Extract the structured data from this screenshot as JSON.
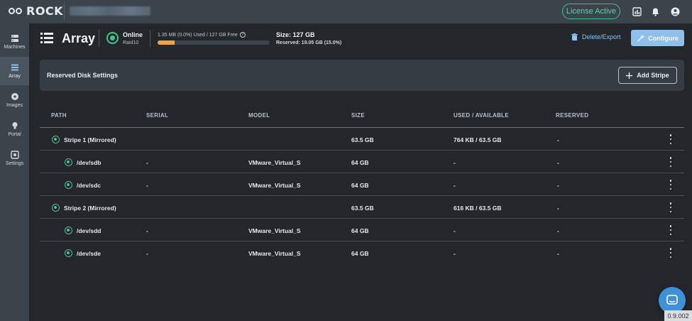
{
  "app": {
    "logo_text": "ROCK",
    "license_label": "License Active",
    "version": "0.9.002"
  },
  "sidebar": {
    "items": [
      {
        "label": "Machines"
      },
      {
        "label": "Array"
      },
      {
        "label": "Images"
      },
      {
        "label": "Portal"
      },
      {
        "label": "Settings"
      }
    ]
  },
  "header": {
    "title": "Array",
    "status": "Online",
    "raid": "Raid10",
    "usage_text": "1.35 MB (0.0%) Used / 127 GB Free",
    "usage_percent": 15,
    "size": "Size: 127 GB",
    "reserved": "Reserved: 19.05 GB (15.0%)",
    "delete_label": "Delete/Export",
    "configure_label": "Configure"
  },
  "reserved_panel": {
    "title": "Reserved Disk Settings",
    "add_label": "Add Stripe"
  },
  "table": {
    "columns": [
      "PATH",
      "SERIAL",
      "MODEL",
      "SIZE",
      "USED / AVAILABLE",
      "RESERVED"
    ],
    "rows": [
      {
        "path": "Stripe 1 (Mirrored)",
        "serial": "",
        "model": "",
        "size": "63.5 GB",
        "used": "764 KB / 63.5 GB",
        "reserved": "-"
      },
      {
        "path": "/dev/sdb",
        "serial": "-",
        "model": "VMware_Virtual_S",
        "size": "64 GB",
        "used": "-",
        "reserved": "-"
      },
      {
        "path": "/dev/sdc",
        "serial": "-",
        "model": "VMware_Virtual_S",
        "size": "64 GB",
        "used": "-",
        "reserved": "-"
      },
      {
        "path": "Stripe 2 (Mirrored)",
        "serial": "",
        "model": "",
        "size": "63.5 GB",
        "used": "616 KB / 63.5 GB",
        "reserved": "-"
      },
      {
        "path": "/dev/sdd",
        "serial": "-",
        "model": "VMware_Virtual_S",
        "size": "64 GB",
        "used": "-",
        "reserved": "-"
      },
      {
        "path": "/dev/sde",
        "serial": "-",
        "model": "VMware_Virtual_S",
        "size": "64 GB",
        "used": "-",
        "reserved": "-"
      }
    ]
  }
}
